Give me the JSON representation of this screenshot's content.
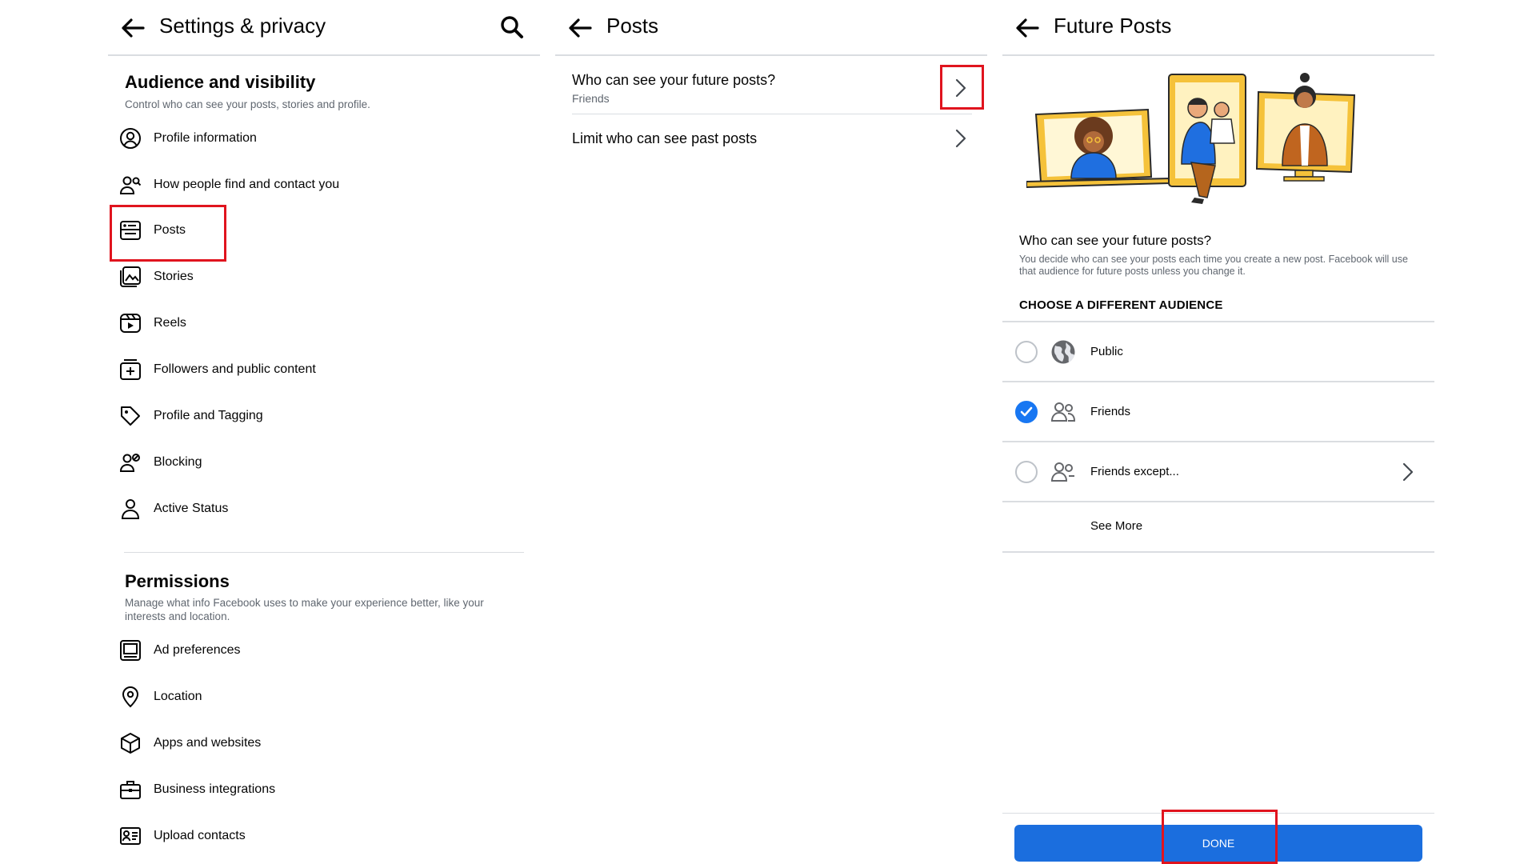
{
  "panel1": {
    "title": "Settings & privacy",
    "audience_title": "Audience and visibility",
    "audience_sub": "Control who can see your posts, stories and profile.",
    "audience_items": [
      {
        "label": "Profile information",
        "icon": "profile-circle-icon"
      },
      {
        "label": "How people find and contact you",
        "icon": "find-people-icon"
      },
      {
        "label": "Posts",
        "icon": "posts-icon"
      },
      {
        "label": "Stories",
        "icon": "stories-icon"
      },
      {
        "label": "Reels",
        "icon": "reels-icon"
      },
      {
        "label": "Followers and public content",
        "icon": "followers-icon"
      },
      {
        "label": "Profile and Tagging",
        "icon": "tag-icon"
      },
      {
        "label": "Blocking",
        "icon": "blocking-icon"
      },
      {
        "label": "Active Status",
        "icon": "active-status-icon"
      }
    ],
    "permissions_title": "Permissions",
    "permissions_sub": "Manage what info Facebook uses to make your experience better, like your interests and location.",
    "permissions_items": [
      {
        "label": "Ad preferences",
        "icon": "ad-preferences-icon"
      },
      {
        "label": "Location",
        "icon": "location-pin-icon"
      },
      {
        "label": "Apps and websites",
        "icon": "cube-icon"
      },
      {
        "label": "Business integrations",
        "icon": "briefcase-icon"
      },
      {
        "label": "Upload contacts",
        "icon": "contacts-card-icon"
      }
    ]
  },
  "panel2": {
    "title": "Posts",
    "rows": [
      {
        "title": "Who can see your future posts?",
        "sub": "Friends"
      },
      {
        "title": "Limit who can see past posts"
      }
    ]
  },
  "panel3": {
    "title": "Future Posts",
    "question": "Who can see your future posts?",
    "description": "You decide who can see your posts each time you create a new post. Facebook will use that audience for future posts unless you change it.",
    "choose_label": "CHOOSE A DIFFERENT AUDIENCE",
    "options": [
      {
        "label": "Public",
        "icon": "globe-icon",
        "selected": false
      },
      {
        "label": "Friends",
        "icon": "friends-icon",
        "selected": true
      },
      {
        "label": "Friends except...",
        "icon": "friends-except-icon",
        "selected": false
      }
    ],
    "see_more": "See More",
    "done": "DONE"
  },
  "colors": {
    "highlight": "#e0141e",
    "accent": "#1877f2",
    "button": "#1b6ede"
  }
}
